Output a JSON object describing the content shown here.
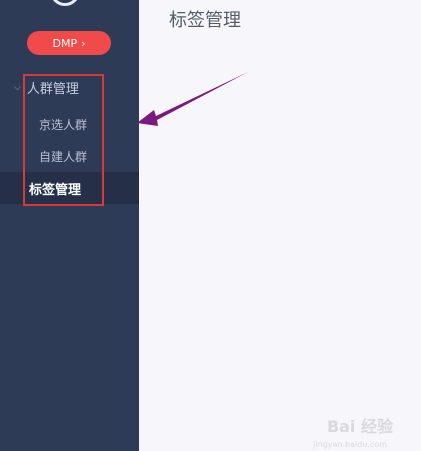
{
  "sidebar": {
    "dmp_button": {
      "label": "DMP",
      "chevron": "›"
    },
    "group": {
      "label": "人群管理",
      "expand_icon": "chevron-down-icon",
      "items": [
        {
          "label": "京选人群"
        },
        {
          "label": "自建人群"
        }
      ]
    },
    "active_item": {
      "label": "标签管理"
    }
  },
  "main": {
    "title": "标签管理"
  },
  "annotation": {
    "arrow_color": "#7a1a80",
    "highlight_color": "#d83a3a"
  },
  "watermark": {
    "main": "Bai 经验",
    "sub": "jingyan.baidu.com"
  }
}
